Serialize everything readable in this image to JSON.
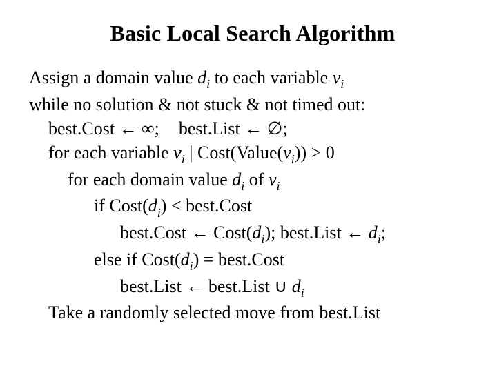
{
  "title": "Basic Local Search Algorithm",
  "sym": {
    "d": "d",
    "v": "v",
    "i": "i",
    "assign": "←",
    "inf": "∞",
    "empty": "∅",
    "cup": "∪"
  },
  "l1": {
    "a": "Assign a domain value ",
    "b": " to each variable "
  },
  "l2": "while no solution & not stuck & not timed out:",
  "l3": {
    "a": "best.Cost ",
    "b": " ",
    "c": ";",
    "d": "best.List ",
    "e": " ",
    "f": ";"
  },
  "l4": {
    "a": "for each variable ",
    "b": " | Cost(Value(",
    "c": ")) > 0"
  },
  "l5": {
    "a": "for each domain value ",
    "b": " of "
  },
  "l6": {
    "a": "if Cost(",
    "b": ") < best.Cost"
  },
  "l7": {
    "a": "best.Cost ",
    "b": " Cost(",
    "c": "); best.List ",
    "d": " ",
    "e": ";"
  },
  "l8": {
    "a": "else if Cost(",
    "b": ") = best.Cost"
  },
  "l9": {
    "a": "best.List ",
    "b": " best.List ",
    "c": " "
  },
  "l10": "Take a randomly selected move from best.List"
}
